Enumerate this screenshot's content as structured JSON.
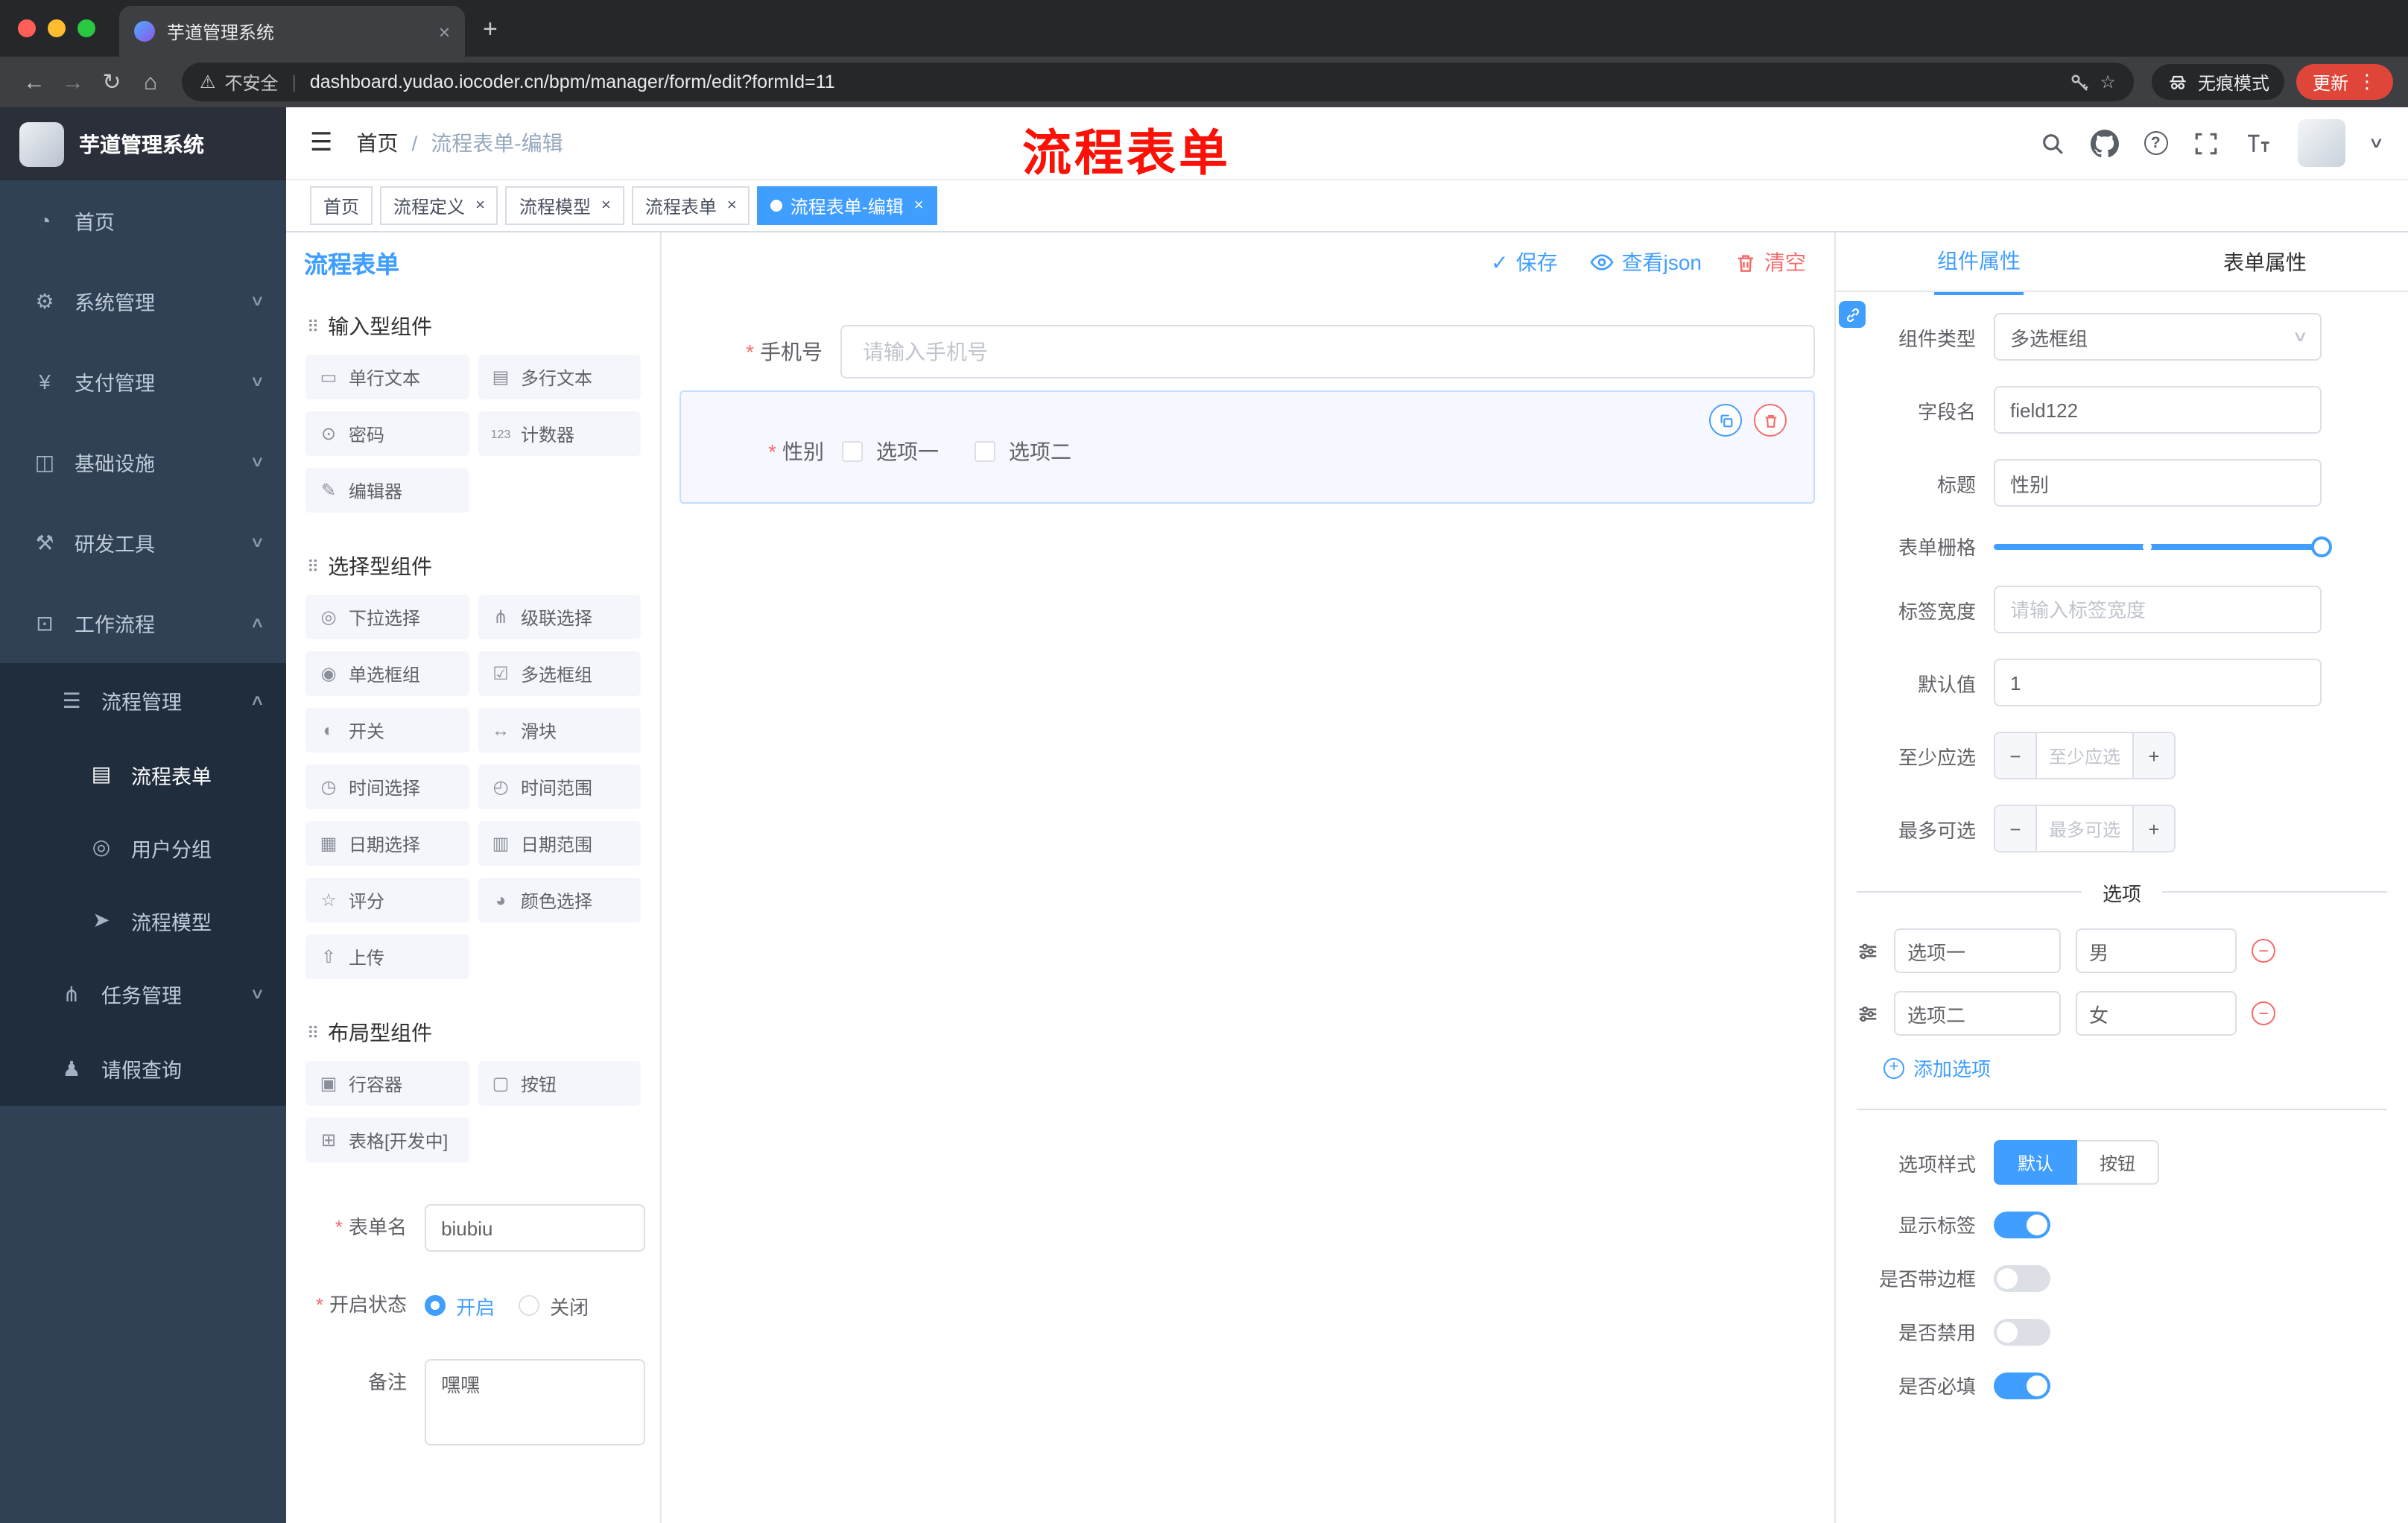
{
  "browser": {
    "tab_title": "芋道管理系统",
    "security_label": "不安全",
    "url": "dashboard.yudao.iocoder.cn/bpm/manager/form/edit?formId=11",
    "incognito_label": "无痕模式",
    "update_label": "更新"
  },
  "icons": {
    "back": "←",
    "forward": "→",
    "reload": "↻",
    "home": "⌂",
    "plus": "+",
    "close": "×",
    "kebab": "⋮",
    "warning": "⚠",
    "divider": "|",
    "star": "☆",
    "hamburger": "☰",
    "caret_down": "∨",
    "chev_down": "∨",
    "chev_up": "∧",
    "check": "✓",
    "question": "?",
    "drag": "⠿",
    "minus": "−",
    "dot": "●"
  },
  "annotation": "流程表单",
  "sidebar": {
    "logo_title": "芋道管理系统",
    "menu": [
      {
        "icon": "◔",
        "label": "首页"
      },
      {
        "icon": "⚙",
        "label": "系统管理"
      },
      {
        "icon": "¥",
        "label": "支付管理"
      },
      {
        "icon": "◫",
        "label": "基础设施"
      },
      {
        "icon": "⚒",
        "label": "研发工具"
      },
      {
        "icon": "⊡",
        "label": "工作流程"
      },
      {
        "icon": "☰",
        "label": "流程管理"
      },
      {
        "icon": "▤",
        "label": "流程表单"
      },
      {
        "icon": "◎",
        "label": "用户分组"
      },
      {
        "icon": "➤",
        "label": "流程模型"
      },
      {
        "icon": "⋔",
        "label": "任务管理"
      },
      {
        "icon": "♟",
        "label": "请假查询"
      }
    ]
  },
  "header": {
    "breadcrumb_home": "首页",
    "breadcrumb_sep": "/",
    "breadcrumb_current": "流程表单-编辑"
  },
  "tags": [
    {
      "label": "首页"
    },
    {
      "label": "流程定义"
    },
    {
      "label": "流程模型"
    },
    {
      "label": "流程表单"
    },
    {
      "label": "流程表单-编辑"
    }
  ],
  "palette": {
    "title": "流程表单",
    "groups": [
      {
        "name": "输入型组件",
        "items": [
          {
            "icon": "▭",
            "label": "单行文本"
          },
          {
            "icon": "▤",
            "label": "多行文本"
          },
          {
            "icon": "⊙",
            "label": "密码"
          },
          {
            "icon": "123",
            "label": "计数器"
          },
          {
            "icon": "✎",
            "label": "编辑器"
          }
        ]
      },
      {
        "name": "选择型组件",
        "items": [
          {
            "icon": "◎",
            "label": "下拉选择"
          },
          {
            "icon": "⋔",
            "label": "级联选择"
          },
          {
            "icon": "◉",
            "label": "单选框组"
          },
          {
            "icon": "☑",
            "label": "多选框组"
          },
          {
            "icon": "◐",
            "label": "开关"
          },
          {
            "icon": "↔",
            "label": "滑块"
          },
          {
            "icon": "◷",
            "label": "时间选择"
          },
          {
            "icon": "◴",
            "label": "时间范围"
          },
          {
            "icon": "▦",
            "label": "日期选择"
          },
          {
            "icon": "▥",
            "label": "日期范围"
          },
          {
            "icon": "☆",
            "label": "评分"
          },
          {
            "icon": "◕",
            "label": "颜色选择"
          },
          {
            "icon": "⇧",
            "label": "上传"
          }
        ]
      },
      {
        "name": "布局型组件",
        "items": [
          {
            "icon": "▣",
            "label": "行容器"
          },
          {
            "icon": "▢",
            "label": "按钮"
          },
          {
            "icon": "⊞",
            "label": "表格[开发中]"
          }
        ]
      }
    ],
    "form": {
      "name_label": "表单名",
      "name_value": "biubiu",
      "status_label": "开启状态",
      "status_on": "开启",
      "status_off": "关闭",
      "remark_label": "备注",
      "remark_value": "嘿嘿"
    }
  },
  "canvas": {
    "save_label": "保存",
    "view_json_label": "查看json",
    "clear_label": "清空",
    "phone": {
      "label": "手机号",
      "placeholder": "请输入手机号"
    },
    "gender": {
      "label": "性别",
      "option1": "选项一",
      "option2": "选项二"
    }
  },
  "props": {
    "tab_component": "组件属性",
    "tab_form": "表单属性",
    "component_type_label": "组件类型",
    "component_type_value": "多选框组",
    "field_name_label": "字段名",
    "field_name_value": "field122",
    "title_label": "标题",
    "title_value": "性别",
    "grid_label": "表单栅格",
    "label_width_label": "标签宽度",
    "label_width_placeholder": "请输入标签宽度",
    "default_label": "默认值",
    "default_value": "1",
    "min_label": "至少应选",
    "min_placeholder": "至少应选",
    "max_label": "最多可选",
    "max_placeholder": "最多可选",
    "options_title": "选项",
    "options": [
      {
        "name": "选项一",
        "value": "男"
      },
      {
        "name": "选项二",
        "value": "女"
      }
    ],
    "add_option_label": "添加选项",
    "option_style_label": "选项样式",
    "style_default": "默认",
    "style_button": "按钮",
    "show_label_label": "显示标签",
    "border_label": "是否带边框",
    "disabled_label": "是否禁用",
    "required_label": "是否必填"
  },
  "colors": {
    "primary": "#409eff",
    "danger": "#f56c6c",
    "sidebar_bg": "#304156",
    "submenu_bg": "#1f2d3d"
  }
}
